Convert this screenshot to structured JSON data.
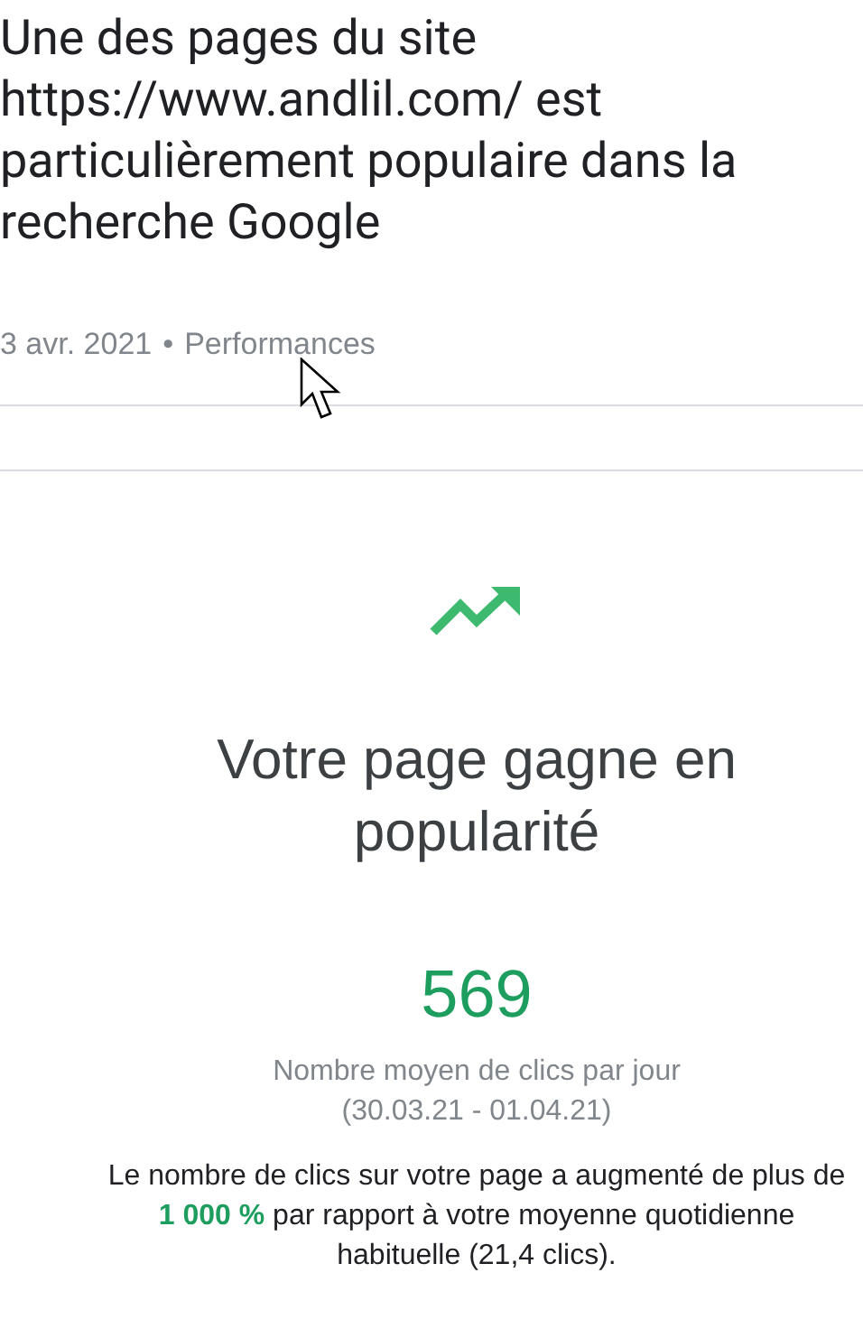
{
  "title": "Une des pages du site https://www.andlil.com/ est particulièrement populaire dans la recherche Google",
  "meta": {
    "date": "3 avr. 2021",
    "separator": "•",
    "category": "Performances"
  },
  "card": {
    "heading": "Votre page gagne en popularité",
    "value": "569",
    "value_label": "Nombre moyen de clics par jour",
    "period": "(30.03.21 - 01.04.21)",
    "summary": "Le nombre de clics sur votre page a augmenté de plus de **1 000 %** par rapport à votre moyenne quotidienne habituelle (21,4 clics)."
  }
}
